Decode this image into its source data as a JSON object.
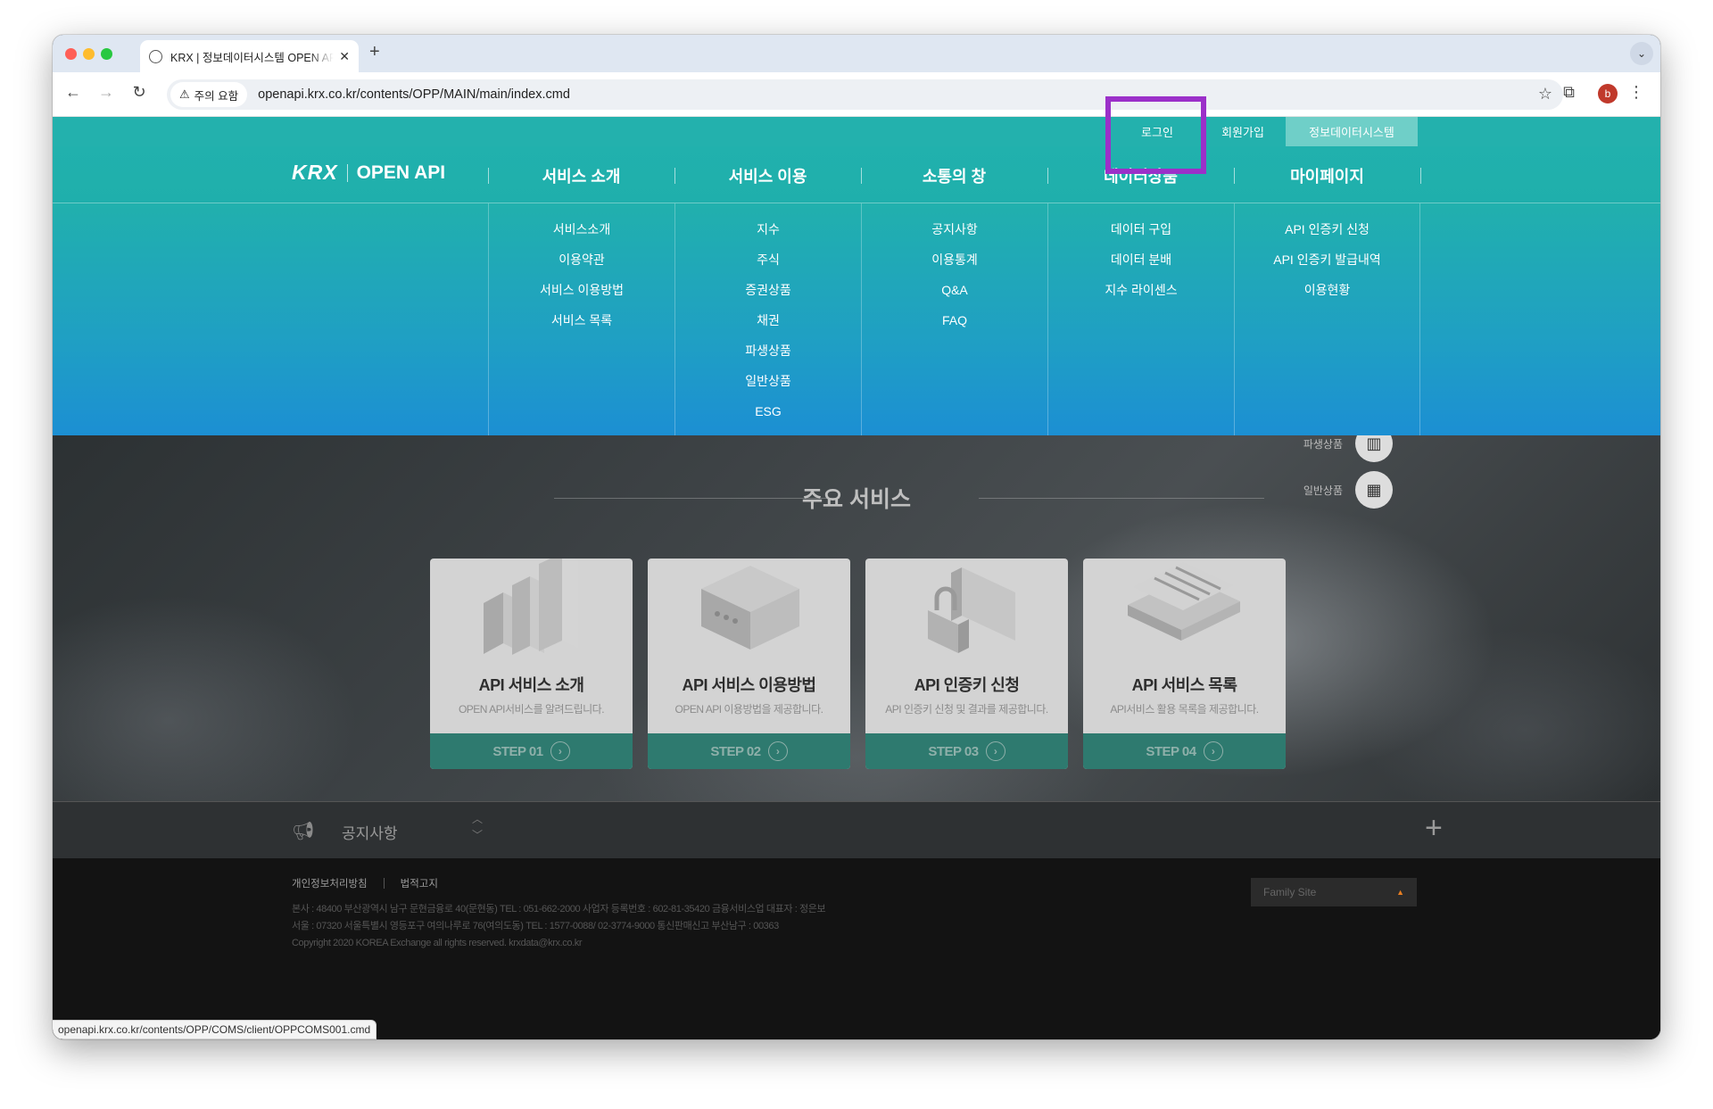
{
  "browser": {
    "tab_title": "KRX | 정보데이터시스템 OPEN API",
    "tab_close": "✕",
    "new_tab": "+",
    "security_label": "주의 요함",
    "url": "openapi.krx.co.kr/contents/OPP/MAIN/main/index.cmd",
    "profile_initial": "b",
    "status_url": "openapi.krx.co.kr/contents/OPP/COMS/client/OPPCOMS001.cmd"
  },
  "util_bar": {
    "login": "로그인",
    "signup": "회원가입",
    "data_system": "정보데이터시스템"
  },
  "logo": {
    "brand": "KRX",
    "product": "OPEN API"
  },
  "menu": [
    {
      "label": "서비스 소개",
      "items": [
        "서비스소개",
        "이용약관",
        "서비스 이용방법",
        "서비스 목록"
      ]
    },
    {
      "label": "서비스 이용",
      "items": [
        "지수",
        "주식",
        "증권상품",
        "채권",
        "파생상품",
        "일반상품",
        "ESG"
      ]
    },
    {
      "label": "소통의 창",
      "items": [
        "공지사항",
        "이용통계",
        "Q&A",
        "FAQ"
      ]
    },
    {
      "label": "데이터상품",
      "items": [
        "데이터 구입",
        "데이터 분배",
        "지수 라이센스"
      ]
    },
    {
      "label": "마이페이지",
      "items": [
        "API 인증키 신청",
        "API 인증키 발급내역",
        "이용현황"
      ]
    }
  ],
  "side_icons": {
    "derivatives": "파생상품",
    "commodities": "일반상품"
  },
  "services": {
    "title": "주요 서비스",
    "cards": [
      {
        "title": "API 서비스 소개",
        "desc": "OPEN API서비스를 알려드립니다.",
        "step": "STEP 01"
      },
      {
        "title": "API 서비스 이용방법",
        "desc": "OPEN API 이용방법을 제공합니다.",
        "step": "STEP 02"
      },
      {
        "title": "API 인증키 신청",
        "desc": "API 인증키 신청 및 결과를 제공합니다.",
        "step": "STEP 03"
      },
      {
        "title": "API 서비스 목록",
        "desc": "API서비스 활용 목록을 제공합니다.",
        "step": "STEP 04"
      }
    ]
  },
  "notice": {
    "label": "공지사항",
    "more": "+"
  },
  "footer": {
    "privacy": "개인정보처리방침",
    "legal": "법적고지",
    "address1": "본사 : 48400 부산광역시 남구 문현금융로 40(문현동) TEL : 051-662-2000 사업자 등록번호 : 602-81-35420 금융서비스업 대표자 : 정은보",
    "address2": "서울 : 07320 서울특별시 영등포구 여의나루로 76(여의도동) TEL : 1577-0088/ 02-3774-9000 통신판매신고 부산남구 : 00363",
    "copyright": "Copyright 2020 KOREA Exchange all rights reserved. krxdata@krx.co.kr",
    "family_site": "Family Site"
  },
  "colors": {
    "teal": "#23b1ad",
    "blue": "#1c8fd3",
    "step_bar": "#2e7a6f",
    "highlight": "#9b30c9"
  }
}
